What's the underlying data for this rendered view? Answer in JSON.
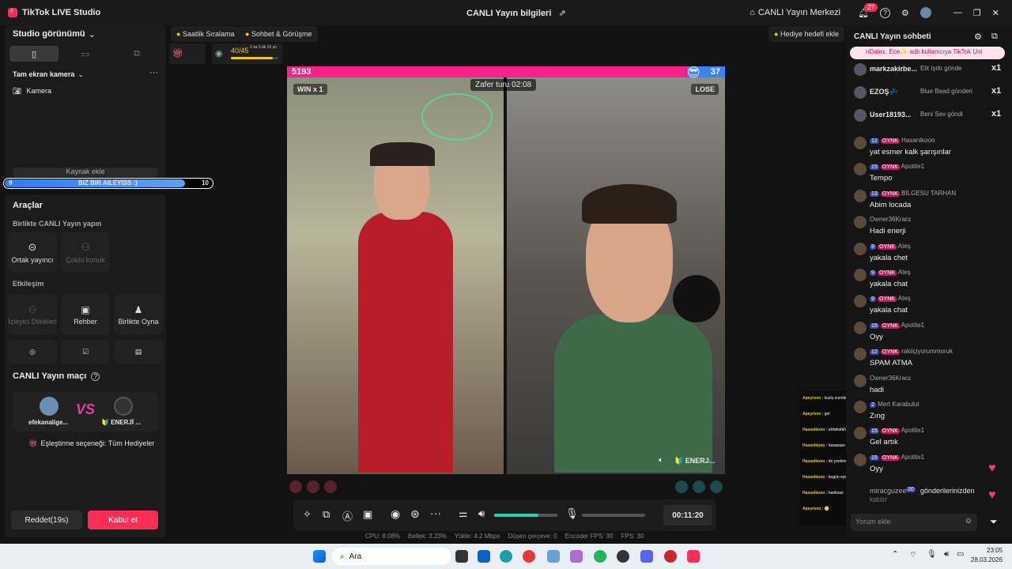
{
  "titlebar": {
    "app_title": "TikTok LIVE Studio",
    "center_title": "CANLI Yayın bilgileri",
    "live_center": "CANLI Yayın Merkezi",
    "notifications": "27"
  },
  "left": {
    "studio_view": "Studio görünümü",
    "camera_section": "Tam ekran kamera",
    "camera_item": "Kamera",
    "add_source": "Kaynak ekle",
    "goal_bar": {
      "left": "9",
      "label": "BIZ BIR AILEYISS :)",
      "right": "10",
      "progress": 0.95
    },
    "tools_title": "Araçlar",
    "together_title": "Birlikte CANLI Yayın yapın",
    "cohost": "Ortak yayıncı",
    "multi_guest": "Çoklu konuk",
    "interaction_title": "Etkileşim",
    "viewer_requests": "İzleyici Dilekleri",
    "guide": "Rehber",
    "play_together": "Birlikte Oyna",
    "match_title": "CANLI Yayın maçı",
    "player1": "efekanalige...",
    "player2": "🔰 ENERJİ ...",
    "vs": "VS",
    "match_option": "Eşleştirme seçeneği: Tüm Hediyeler",
    "decline": "Reddet(19s)",
    "accept": "Kabul et"
  },
  "center": {
    "hourly_rank": "Saatlik Sıralama",
    "chat_meet": "Sohbet & Görüşme",
    "add_gift_goal": "Hediye hedefi ekle",
    "rank_progress": "40/45",
    "rank_time": "2 sa 0 dk 15 sn",
    "rank_fill": 0.89,
    "battle": {
      "left_score": "5193",
      "right_score": "37",
      "win_label": "WIN x 1",
      "lose_label": "LOSE",
      "timer": "Zafer turu 02:08",
      "right_name": "🔰 ENERJ..."
    },
    "elapsed": "00:11:20",
    "volume": 0.7,
    "stats": [
      "CPU: 8.08%",
      "Bellek: 3.23%",
      "Yükle: 4.2 Mbps",
      "Düşen çerçeve: 0",
      "Encoder FPS: 30",
      "FPS: 30"
    ]
  },
  "chat": {
    "title": "CANLI Yayın sohbeti",
    "banner": "nDalırε, Ece✨ adlı kullanıcıya TikTok Uni",
    "gifts": [
      {
        "user": "markzakirbe...",
        "gift": "Elit Işıltı gönde",
        "count": "x1"
      },
      {
        "user": "EZOŞ💤",
        "gift": "Blue Bead gönderi",
        "count": "x1"
      },
      {
        "user": "User18193...",
        "gift": "Beni Sev göndi",
        "count": "x1"
      }
    ],
    "messages": [
      {
        "level": "12",
        "fan": "OYNK",
        "user": "Hasanikooo",
        "text": "yat esmer kalk şarışınlar"
      },
      {
        "level": "15",
        "fan": "OYNK",
        "user": "Apotite1",
        "text": "Tempo"
      },
      {
        "level": "13",
        "fan": "OYNK",
        "user": "BİLGESU TARHAN",
        "text": "Abim locada"
      },
      {
        "level": "",
        "fan": "",
        "user": "Owner36Kracε",
        "text": "Hadi enerji"
      },
      {
        "level": "9",
        "fan": "OYNK",
        "user": "Ateş",
        "text": "yakala chet"
      },
      {
        "level": "9",
        "fan": "OYNK",
        "user": "Ateş",
        "text": "yakala chat"
      },
      {
        "level": "9",
        "fan": "OYNK",
        "user": "Ateş",
        "text": "yakala chat"
      },
      {
        "level": "15",
        "fan": "OYNK",
        "user": "Apotite1",
        "text": "Oyy"
      },
      {
        "level": "12",
        "fan": "OYNK",
        "user": "rakiiçiyorummoruk",
        "text": "SPAM ATMA"
      },
      {
        "level": "",
        "fan": "",
        "user": "Owner36Kracε",
        "text": "hadi"
      },
      {
        "level": "2",
        "fan": "",
        "user": "Mert Karabulut",
        "text": "Zıng"
      },
      {
        "level": "15",
        "fan": "OYNK",
        "user": "Apotite1",
        "text": "Gel artık"
      },
      {
        "level": "15",
        "fan": "OYNK",
        "user": "Apotite1",
        "text": "Oyy"
      }
    ],
    "last_line": {
      "user": "miracguzee",
      "level": "20",
      "text": "gönderilerinizden",
      "tail": "katılır"
    },
    "input_placeholder": "Yorum ekle"
  },
  "overlay_chat": [
    {
      "user": "Apeyronn :",
      "text": "kuzlu iceride organizeyi"
    },
    {
      "user": "Apeyronn :",
      "text": "gel"
    },
    {
      "user": "Hasanikooo :",
      "text": "ahfahafahfas"
    },
    {
      "user": "Hasanikooo :",
      "text": "hasasass"
    },
    {
      "user": "Hasanikooo :",
      "text": "do yeekimi ver hasasas"
    },
    {
      "user": "Hasanikooo :",
      "text": "bugün eyeficam onu abi"
    },
    {
      "user": "Hasanikooo :",
      "text": "hariksan"
    },
    {
      "user": "Apeyronn :",
      "text": "🪙"
    }
  ],
  "taskbar": {
    "search": "Ara",
    "time": "23:05",
    "date": "28.03.2026"
  },
  "colors": {
    "accent": "#fe2c55",
    "blue": "#2b7bff",
    "bg": "#121212"
  }
}
